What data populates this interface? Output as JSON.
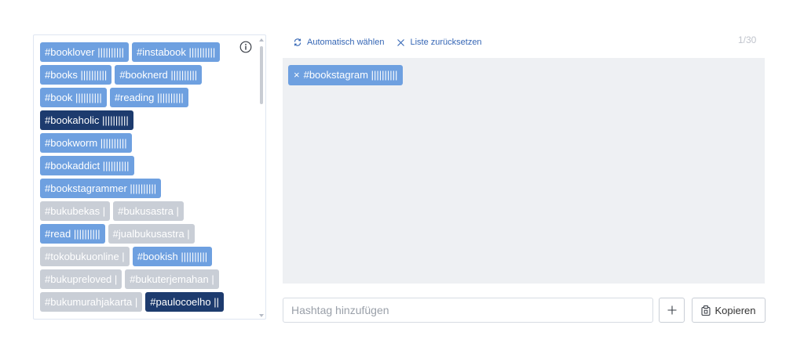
{
  "suggestions": {
    "rows": [
      [
        {
          "label": "#booklover ||||||||||",
          "style": "light"
        },
        {
          "label": "#instabook ||||||||||",
          "style": "light"
        }
      ],
      [
        {
          "label": "#books ||||||||||",
          "style": "light"
        },
        {
          "label": "#booknerd ||||||||||",
          "style": "light"
        }
      ],
      [
        {
          "label": "#book ||||||||||",
          "style": "light"
        },
        {
          "label": "#reading ||||||||||",
          "style": "light"
        }
      ],
      [
        {
          "label": "#bookaholic ||||||||||",
          "style": "dark"
        }
      ],
      [
        {
          "label": "#bookworm ||||||||||",
          "style": "light"
        }
      ],
      [
        {
          "label": "#bookaddict ||||||||||",
          "style": "light"
        }
      ],
      [
        {
          "label": "#bookstagrammer ||||||||||",
          "style": "light"
        }
      ],
      [
        {
          "label": "#bukubekas |",
          "style": "gray"
        },
        {
          "label": "#bukusastra |",
          "style": "gray"
        }
      ],
      [
        {
          "label": "#read ||||||||||",
          "style": "light"
        },
        {
          "label": "#jualbukusastra |",
          "style": "gray"
        }
      ],
      [
        {
          "label": "#tokobukuonline |",
          "style": "gray"
        },
        {
          "label": "#bookish ||||||||||",
          "style": "light"
        }
      ],
      [
        {
          "label": "#bukupreloved |",
          "style": "gray"
        },
        {
          "label": "#bukuterjemahan |",
          "style": "gray"
        }
      ],
      [
        {
          "label": "#bukumurahjakarta |",
          "style": "gray"
        },
        {
          "label": "#paulocoelho ||",
          "style": "dark"
        }
      ]
    ],
    "info_icon": "info-circle-icon"
  },
  "actions": {
    "auto_select_label": "Automatisch wählen",
    "auto_select_icon": "auto-select-icon",
    "reset_label": "Liste zurücksetzen",
    "reset_icon": "close-icon"
  },
  "counter": "1/30",
  "selected": [
    {
      "label": "#bookstagram ||||||||||",
      "remove_glyph": "×"
    }
  ],
  "input": {
    "placeholder": "Hashtag hinzufügen",
    "value": ""
  },
  "buttons": {
    "add_glyph": "+",
    "copy_label": "Kopieren",
    "copy_icon": "copy-icon"
  },
  "colors": {
    "tag_light": "#6ea0e0",
    "tag_dark": "#1d3b6e",
    "tag_gray": "#c9ced6",
    "link": "#3566b5",
    "selected_bg": "#eef0f3"
  }
}
